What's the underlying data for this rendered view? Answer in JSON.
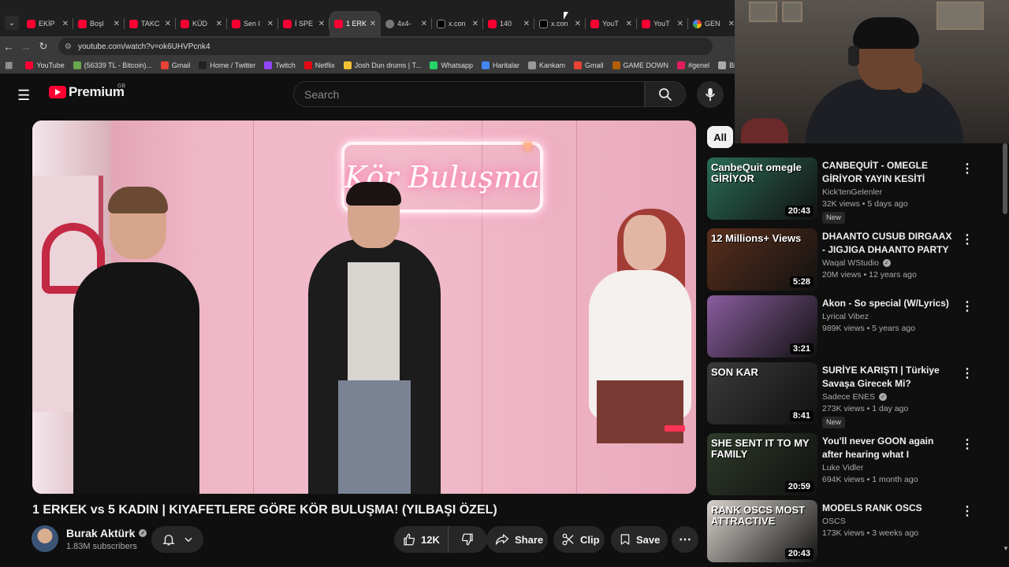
{
  "browser": {
    "tabs": [
      {
        "label": "EKİP",
        "icon": "youtube-icon",
        "active": false
      },
      {
        "label": "Boşl",
        "icon": "youtube-icon",
        "active": false
      },
      {
        "label": "TAKC",
        "icon": "youtube-icon",
        "active": false
      },
      {
        "label": "KÜD",
        "icon": "youtube-icon",
        "active": false
      },
      {
        "label": "Sen I",
        "icon": "youtube-icon",
        "active": false
      },
      {
        "label": "İ SPE",
        "icon": "youtube-icon",
        "active": false
      },
      {
        "label": "1 ERK",
        "icon": "youtube-icon",
        "active": true
      },
      {
        "label": "4x4-",
        "icon": "web-icon",
        "active": false
      },
      {
        "label": "x.con",
        "icon": "x-icon",
        "active": false
      },
      {
        "label": "140",
        "icon": "youtube-icon",
        "active": false
      },
      {
        "label": "x.con",
        "icon": "x-icon",
        "active": false
      },
      {
        "label": "YouT",
        "icon": "youtube-icon",
        "active": false
      },
      {
        "label": "YouT",
        "icon": "youtube-icon",
        "active": false
      },
      {
        "label": "GEN",
        "icon": "google-icon",
        "active": false
      }
    ],
    "url": "youtube.com/watch?v=ok6UHVPcnk4",
    "bookmarks": [
      {
        "label": "YouTube",
        "color": "#ff0033"
      },
      {
        "label": "(56339 TL - Bitcoin)...",
        "color": "#6aa84f"
      },
      {
        "label": "Gmail",
        "color": "#ea4335"
      },
      {
        "label": "Home / Twitter",
        "color": "#222222"
      },
      {
        "label": "Twitch",
        "color": "#9146ff"
      },
      {
        "label": "Netflix",
        "color": "#e50914"
      },
      {
        "label": "Josh Dun drums | T...",
        "color": "#f1c232"
      },
      {
        "label": "Whatsapp",
        "color": "#25d366"
      },
      {
        "label": "Haritalar",
        "color": "#4285f4"
      },
      {
        "label": "Kankam",
        "color": "#999999"
      },
      {
        "label": "Gmail",
        "color": "#ea4335"
      },
      {
        "label": "GAME DOWN",
        "color": "#b45f06"
      },
      {
        "label": "#genel",
        "color": "#e01e5a"
      },
      {
        "label": "Binance",
        "color": "#aaaaaa"
      }
    ]
  },
  "header": {
    "logo": "Premium",
    "country": "GB",
    "search_placeholder": "Search"
  },
  "video": {
    "neon_sign": "Kör Buluşma",
    "title": "1 ERKEK vs 5 KADIN | KIYAFETLERE GÖRE KÖR BULUŞMA! (YILBAŞI ÖZEL)",
    "channel": "Burak Aktürk",
    "subscribers": "1.83M subscribers",
    "likes": "12K",
    "share_label": "Share",
    "clip_label": "Clip",
    "save_label": "Save"
  },
  "sidebar": {
    "chip_all": "All",
    "items": [
      {
        "title": "CANBEQUİT - OMEGLE GİRİYOR YAYIN KESİTİ",
        "channel": "Kick'tenGelenler",
        "verified": false,
        "views": "32K views • 5 days ago",
        "new": "New",
        "duration": "20:43",
        "thumb_text": "CanbeQuit omegle GİRİYOR",
        "thumb_color": "#2b6b57"
      },
      {
        "title": "DHAANTO CUSUB DIRGAAX - JIGJIGA DHAANTO PARTY ...",
        "channel": "Waqal WStudio",
        "verified": true,
        "views": "20M views • 12 years ago",
        "new": "",
        "duration": "5:28",
        "thumb_text": "12 Millions+ Views",
        "thumb_color": "#5a2f1c"
      },
      {
        "title": "Akon - So special (W/Lyrics)",
        "channel": "Lyrical Vibez",
        "verified": false,
        "views": "989K views • 5 years ago",
        "new": "",
        "duration": "3:21",
        "thumb_text": "",
        "thumb_color": "#8a5d9e"
      },
      {
        "title": "SURİYE KARIŞTI | Türkiye Savaşa Girecek Mi?",
        "channel": "Sadece ENES",
        "verified": true,
        "views": "273K views • 1 day ago",
        "new": "New",
        "duration": "8:41",
        "thumb_text": "SON KAR",
        "thumb_color": "#3a3a3a"
      },
      {
        "title": "You'll never GOON again after hearing what I shamefully did...",
        "channel": "Luke Vidler",
        "verified": false,
        "views": "694K views • 1 month ago",
        "new": "",
        "duration": "20:59",
        "thumb_text": "SHE SENT IT TO MY FAMILY",
        "thumb_color": "#2e3a2a"
      },
      {
        "title": "MODELS RANK OSCS",
        "channel": "OSCS",
        "verified": false,
        "views": "173K views • 3 weeks ago",
        "new": "",
        "duration": "20:43",
        "thumb_text": "RANK OSCS MOST ATTRACTIVE",
        "thumb_color": "#d7d2cc"
      }
    ]
  }
}
